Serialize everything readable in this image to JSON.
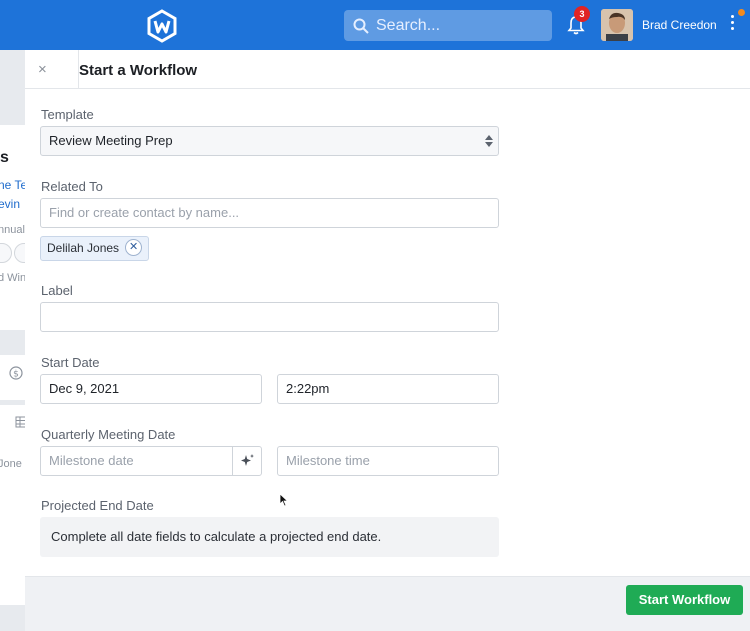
{
  "topbar": {
    "search_placeholder": "Search...",
    "notification_count": "3",
    "user_name": "Brad Creedon"
  },
  "background_page": {
    "heading_fragment": "s",
    "link1_fragment": "ne Te",
    "link2_fragment": "evin",
    "small1_fragment": "nnual",
    "small2_fragment": "d Win",
    "small3_fragment": "Jone"
  },
  "panel": {
    "title": "Start a Workflow",
    "close_label": "×",
    "template_label": "Template",
    "template_value": "Review Meeting Prep",
    "related_label": "Related To",
    "related_placeholder": "Find or create contact by name...",
    "related_tag": "Delilah Jones",
    "label_label": "Label",
    "start_date_label": "Start Date",
    "start_date_value": "Dec 9, 2021",
    "start_time_value": "2:22pm",
    "quarterly_label": "Quarterly Meeting Date",
    "milestone_date_placeholder": "Milestone date",
    "milestone_time_placeholder": "Milestone time",
    "projected_label": "Projected End Date",
    "projected_info": "Complete all date fields to calculate a projected end date.",
    "start_button": "Start Workflow"
  },
  "colors": {
    "topbar": "#1e73d9",
    "primary_button": "#1fab55",
    "badge": "#e02424"
  }
}
